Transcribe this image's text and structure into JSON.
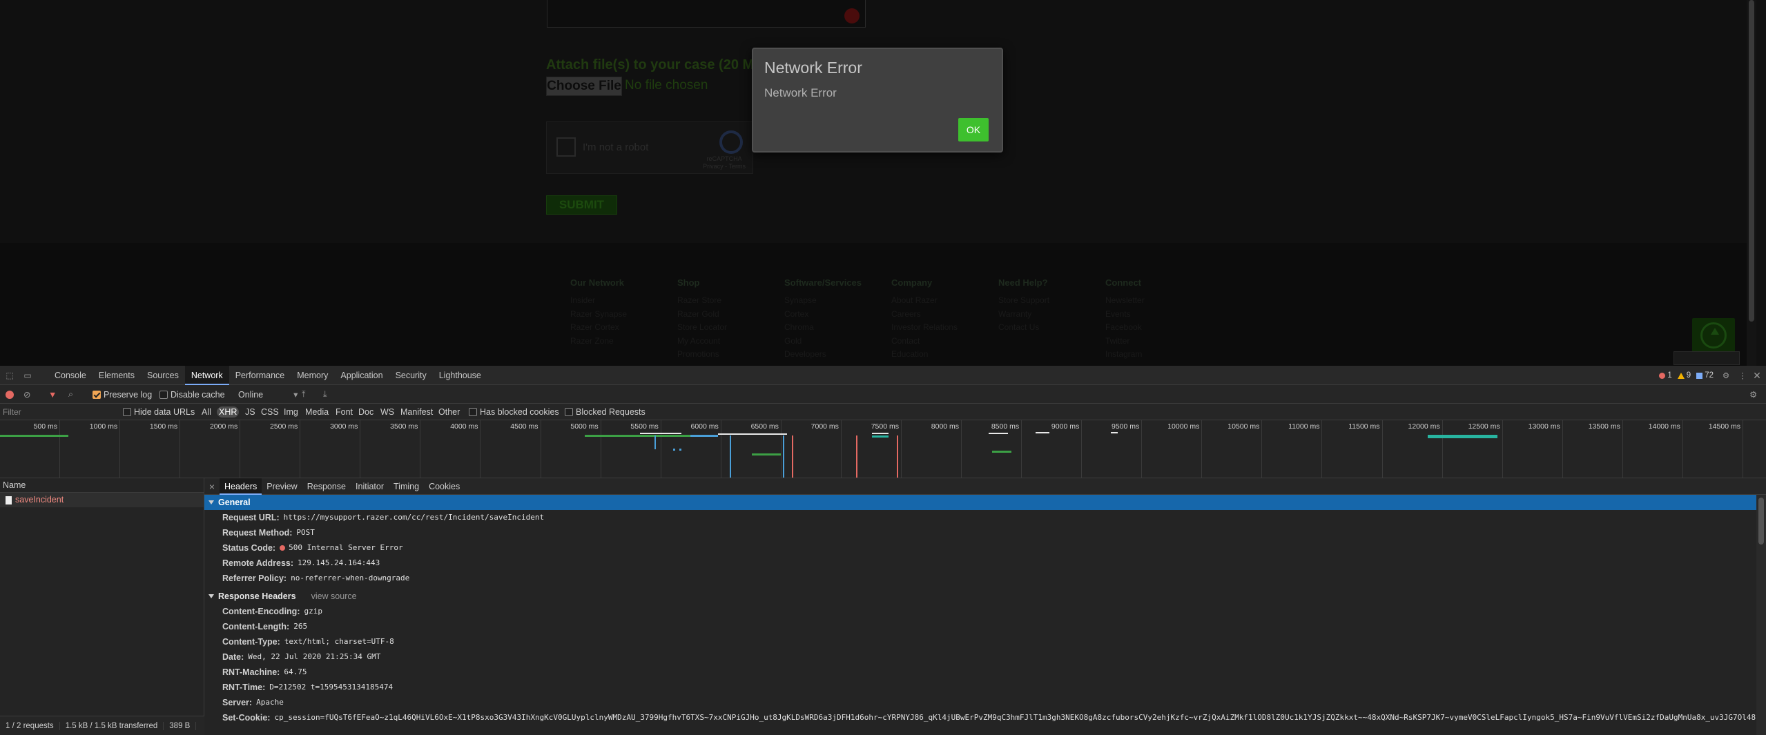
{
  "page": {
    "attach_label": "Attach file(s) to your case (20 MB lim",
    "choose_file": "Choose File",
    "no_file": "No file chosen",
    "captcha_label": "I'm not a robot",
    "captcha_brand": "reCAPTCHA",
    "captcha_links": "Privacy - Terms",
    "submit": "SUBMIT",
    "footer": [
      {
        "title": "Our Network",
        "items": [
          "Insider",
          "Razer Synapse",
          "Razer Cortex",
          "Razer Zone"
        ]
      },
      {
        "title": "Shop",
        "items": [
          "Razer Store",
          "Razer Gold",
          "Store Locator",
          "My Account",
          "Promotions"
        ]
      },
      {
        "title": "Software/Services",
        "items": [
          "Synapse",
          "Cortex",
          "Chroma",
          "Gold",
          "Developers"
        ]
      },
      {
        "title": "Company",
        "items": [
          "About Razer",
          "Careers",
          "Investor Relations",
          "Contact",
          "Education"
        ]
      },
      {
        "title": "Need Help?",
        "items": [
          "Store Support",
          "Warranty",
          "Contact Us"
        ]
      },
      {
        "title": "Connect",
        "items": [
          "Newsletter",
          "Events",
          "Facebook",
          "Twitter",
          "Instagram"
        ]
      }
    ]
  },
  "dialog": {
    "title": "Network Error",
    "message": "Network Error",
    "ok": "OK"
  },
  "devtools": {
    "tabs": [
      "Console",
      "Elements",
      "Sources",
      "Network",
      "Performance",
      "Memory",
      "Application",
      "Security",
      "Lighthouse"
    ],
    "active_tab": "Network",
    "counts": {
      "errors": "1",
      "warnings": "9",
      "info": "72"
    },
    "toolbar": {
      "preserve_log": "Preserve log",
      "disable_cache": "Disable cache",
      "throttle": "Online"
    },
    "filter": {
      "placeholder": "Filter",
      "hide_data_urls": "Hide data URLs",
      "types": [
        "All",
        "XHR",
        "JS",
        "CSS",
        "Img",
        "Media",
        "Font",
        "Doc",
        "WS",
        "Manifest",
        "Other"
      ],
      "active_type": "XHR",
      "has_blocked_cookies": "Has blocked cookies",
      "blocked_requests": "Blocked Requests"
    },
    "timeline_ticks": [
      "500 ms",
      "1000 ms",
      "1500 ms",
      "2000 ms",
      "2500 ms",
      "3000 ms",
      "3500 ms",
      "4000 ms",
      "4500 ms",
      "5000 ms",
      "5500 ms",
      "6000 ms",
      "6500 ms",
      "7000 ms",
      "7500 ms",
      "8000 ms",
      "8500 ms",
      "9000 ms",
      "9500 ms",
      "10000 ms",
      "10500 ms",
      "11000 ms",
      "11500 ms",
      "12000 ms",
      "12500 ms",
      "13000 ms",
      "13500 ms",
      "14000 ms",
      "14500 ms"
    ],
    "name_header": "Name",
    "requests": [
      "saveIncident"
    ],
    "status_bar": [
      "1 / 2 requests",
      "1.5 kB / 1.5 kB transferred",
      "389 B"
    ],
    "detail_tabs": [
      "Headers",
      "Preview",
      "Response",
      "Initiator",
      "Timing",
      "Cookies"
    ],
    "general": {
      "title": "General",
      "rows": [
        {
          "k": "Request URL:",
          "v": "https://mysupport.razer.com/cc/rest/Incident/saveIncident"
        },
        {
          "k": "Request Method:",
          "v": "POST"
        },
        {
          "k": "Status Code:",
          "v": "500 Internal Server Error"
        },
        {
          "k": "Remote Address:",
          "v": "129.145.24.164:443"
        },
        {
          "k": "Referrer Policy:",
          "v": "no-referrer-when-downgrade"
        }
      ]
    },
    "response_headers": {
      "title": "Response Headers",
      "view_source": "view source",
      "rows": [
        {
          "k": "Content-Encoding:",
          "v": "gzip"
        },
        {
          "k": "Content-Length:",
          "v": "265"
        },
        {
          "k": "Content-Type:",
          "v": "text/html; charset=UTF-8"
        },
        {
          "k": "Date:",
          "v": "Wed, 22 Jul 2020 21:25:34 GMT"
        },
        {
          "k": "RNT-Machine:",
          "v": "64.75"
        },
        {
          "k": "RNT-Time:",
          "v": "D=212502 t=1595453134185474"
        },
        {
          "k": "Server:",
          "v": "Apache"
        },
        {
          "k": "Set-Cookie:",
          "v": "cp_session=fUQsT6fEFeaO~z1qL46QHiVL6OxE~X1tP8sxo3G3V43IhXngKcV0GLUyplclnyWMDzAU_3799HgfhvT6TXS~7xxCNPiGJHo_ut8JgKLDsWRD6a3jDFH1d6ohr~cYRPNYJ86_qKl4jUBwErPvZM9qC3hmFJlT1m3gh3NEKO8gA8zcfuborsCVy2ehjKzfc~vrZjQxAiZMkf1lOD8lZ0Uc1k1YJSjZQZkkxt~~48xQXNd~RsKSP7JK7~vymeV0CSleLFapclIyngok5_HS7a~Fin9VuVflVEmSi2zfDaUgMnUa8x_uv3JG7Ol48"
        }
      ]
    }
  }
}
